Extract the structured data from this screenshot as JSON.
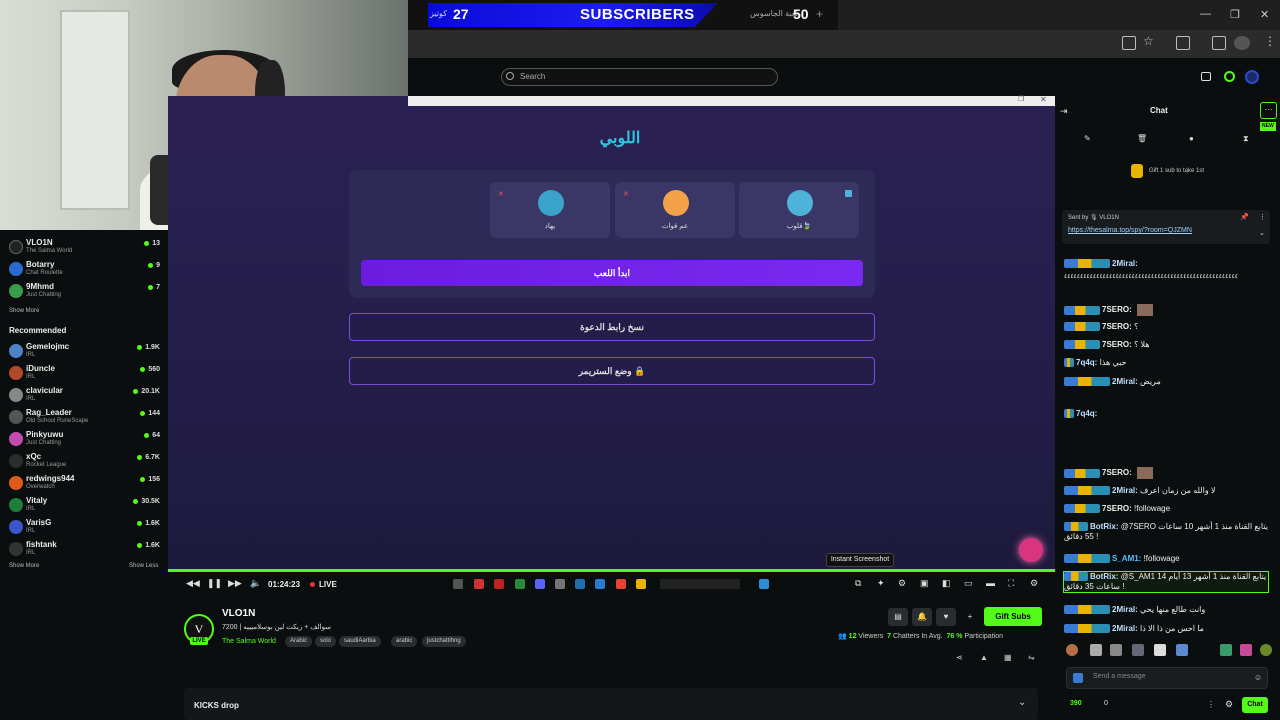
{
  "overlay": {
    "left_count": "27",
    "left_tag": "كوتيز",
    "title": "SUBSCRIBERS",
    "right_count": "50",
    "right_tag": "لعبة الجاسوس",
    "plus": "+"
  },
  "search": {
    "placeholder": "Search"
  },
  "modal": {
    "title": "اللوبي",
    "players": [
      {
        "name": "قلوب🍃",
        "color": "#4fb3d9"
      },
      {
        "name": "عم قوات",
        "color": "#f4a24a"
      },
      {
        "name": "يهاد",
        "color": "#3aa3c9"
      }
    ],
    "start_label": "ابدأ اللعب",
    "copy_invite_label": "نسخ رابط الدعوة",
    "streamer_mode_label": "وضع الستريمر 🔒"
  },
  "sidebar": {
    "following": [
      {
        "name": "VLO1N",
        "category": "The Salma World",
        "count": "13",
        "color": "#222"
      },
      {
        "name": "Botarry",
        "category": "Chat Roulette",
        "count": "9",
        "color": "#2b6bd1"
      },
      {
        "name": "9Mhmd",
        "category": "Just Chatting",
        "count": "7",
        "color": "#3a9d4c"
      }
    ],
    "show_more": "Show More",
    "recommended_title": "Recommended",
    "recommended": [
      {
        "name": "Gemelojmc",
        "category": "IRL",
        "count": "1.9K",
        "color": "#4b83c4"
      },
      {
        "name": "iDuncle",
        "category": "IRL",
        "count": "560",
        "color": "#b04a2a"
      },
      {
        "name": "clavicular",
        "category": "IRL",
        "count": "20.1K",
        "color": "#888"
      },
      {
        "name": "Rag_Leader",
        "category": "Old School RuneScape",
        "count": "144",
        "color": "#555"
      },
      {
        "name": "Pinkyuwu",
        "category": "Just Chatting",
        "count": "64",
        "color": "#c44bb0"
      },
      {
        "name": "xQc",
        "category": "Rocket League",
        "count": "6.7K",
        "color": "#2c2c2c"
      },
      {
        "name": "redwings944",
        "category": "Overwatch",
        "count": "156",
        "color": "#e05b1a"
      },
      {
        "name": "Vitaly",
        "category": "IRL",
        "count": "30.5K",
        "color": "#1f7d3a"
      },
      {
        "name": "VarisG",
        "category": "IRL",
        "count": "1.6K",
        "color": "#3a56c9"
      },
      {
        "name": "fishtank",
        "category": "IRL",
        "count": "1.6K",
        "color": "#333"
      }
    ],
    "show_less": "Show Less"
  },
  "player": {
    "time": "01:24:23",
    "live": "LIVE",
    "tooltip": "Instant Screenshot"
  },
  "channel": {
    "avatar_letter": "V",
    "live_badge": "LIVE",
    "name": "VLO1N",
    "title": "سوالف + ريكت لين بوسلاميييه | 7200",
    "category": "The Salma World",
    "tags": [
      "Arabic",
      "solo",
      "saudiAarbia",
      "arabic",
      "justchattihng"
    ],
    "gift_label": "Gift Subs",
    "viewers": "12",
    "viewers_label": "Viewers",
    "chatters": "7",
    "chatters_label": "Chatters In Avg.",
    "participation": "76 %",
    "participation_label": "Participation"
  },
  "kicks": {
    "label": "KICKS drop"
  },
  "chat": {
    "title": "Chat",
    "new_badge": "NEW",
    "gift_line": "Gift 1 sub to take 1st",
    "pin_by": "Sent by 🎙 VLO1N",
    "pin_link": "https://thesalma.top/spy/?room=QJZMN",
    "messages": [
      {
        "user": "2Miral:",
        "text": "",
        "color": "#bfe0ff"
      },
      {
        "user": "",
        "text": "٤٤٤٤٤٤٤٤٤٤٤٤٤٤٤٤٤٤٤٤٤٤٤٤٤٤٤٤٤٤٤٤٤٤٤٤٤٤٤٤٤٤٤٤٤٤٤٤٤٤٤٤٤٤",
        "color": "#eee"
      },
      {
        "user": "7SERO:",
        "text": "",
        "color": "#eee"
      },
      {
        "user": "7SERO:",
        "text": "؟",
        "color": "#eee"
      },
      {
        "user": "7SERO:",
        "text": "هلا ؟",
        "color": "#eee"
      },
      {
        "user": "7q4q:",
        "text": "حبي هذا",
        "color": "#bfe0ff"
      },
      {
        "user": "2Miral:",
        "text": "مريض",
        "color": "#bfe0ff"
      },
      {
        "user": "7q4q:",
        "text": "",
        "color": "#bfe0ff"
      },
      {
        "user": "7SERO:",
        "text": "",
        "color": "#eee"
      },
      {
        "user": "2Miral:",
        "text": "لا والله من زمان اعرف",
        "color": "#bfe0ff"
      },
      {
        "user": "7SERO:",
        "text": "!followage",
        "color": "#eee"
      },
      {
        "user": "BotRix:",
        "text": "@7SERO يتابع القناة منذ 1 أشهر 10 ساعات 55 دقائق !",
        "color": "#bfe0ff"
      },
      {
        "user": "S_AM1:",
        "text": "!followage",
        "color": "#5bc0ff"
      },
      {
        "user": "BotRix:",
        "text": "@S_AM1 يتابع القناة منذ 1 أشهر 13 أيام 14 ساعات 35 دقائق !",
        "color": "#bfe0ff"
      },
      {
        "user": "2Miral:",
        "text": "وانت طالع منها يحي",
        "color": "#bfe0ff"
      },
      {
        "user": "2Miral:",
        "text": "ما احس من ذا الا ذا",
        "color": "#bfe0ff"
      }
    ],
    "input_placeholder": "Send a message",
    "points": "390",
    "zero": "0",
    "send_label": "Chat"
  }
}
